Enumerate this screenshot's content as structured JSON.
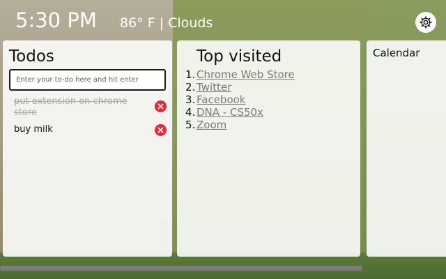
{
  "header": {
    "time": "5:30 PM",
    "weather": "86° F | Clouds"
  },
  "icons": {
    "settings": "gear-icon",
    "delete": "close-icon"
  },
  "colors": {
    "delete_button": "#e02b3a",
    "link": "#7a7a7a",
    "panel_background": "rgba(255,255,255,0.88)"
  },
  "todos": {
    "title": "Todos",
    "input_placeholder": "Enter your to-do here and hit enter",
    "items": [
      {
        "text": "put extension on chrome store",
        "done": true
      },
      {
        "text": "buy milk",
        "done": false
      }
    ]
  },
  "top_visited": {
    "title": "Top visited",
    "items": [
      {
        "number": "1.",
        "label": "Chrome Web Store"
      },
      {
        "number": "2.",
        "label": "Twitter"
      },
      {
        "number": "3.",
        "label": "Facebook"
      },
      {
        "number": "4.",
        "label": "DNA - CS50x"
      },
      {
        "number": "5.",
        "label": "Zoom"
      }
    ]
  },
  "calendar": {
    "title": "Calendar"
  }
}
